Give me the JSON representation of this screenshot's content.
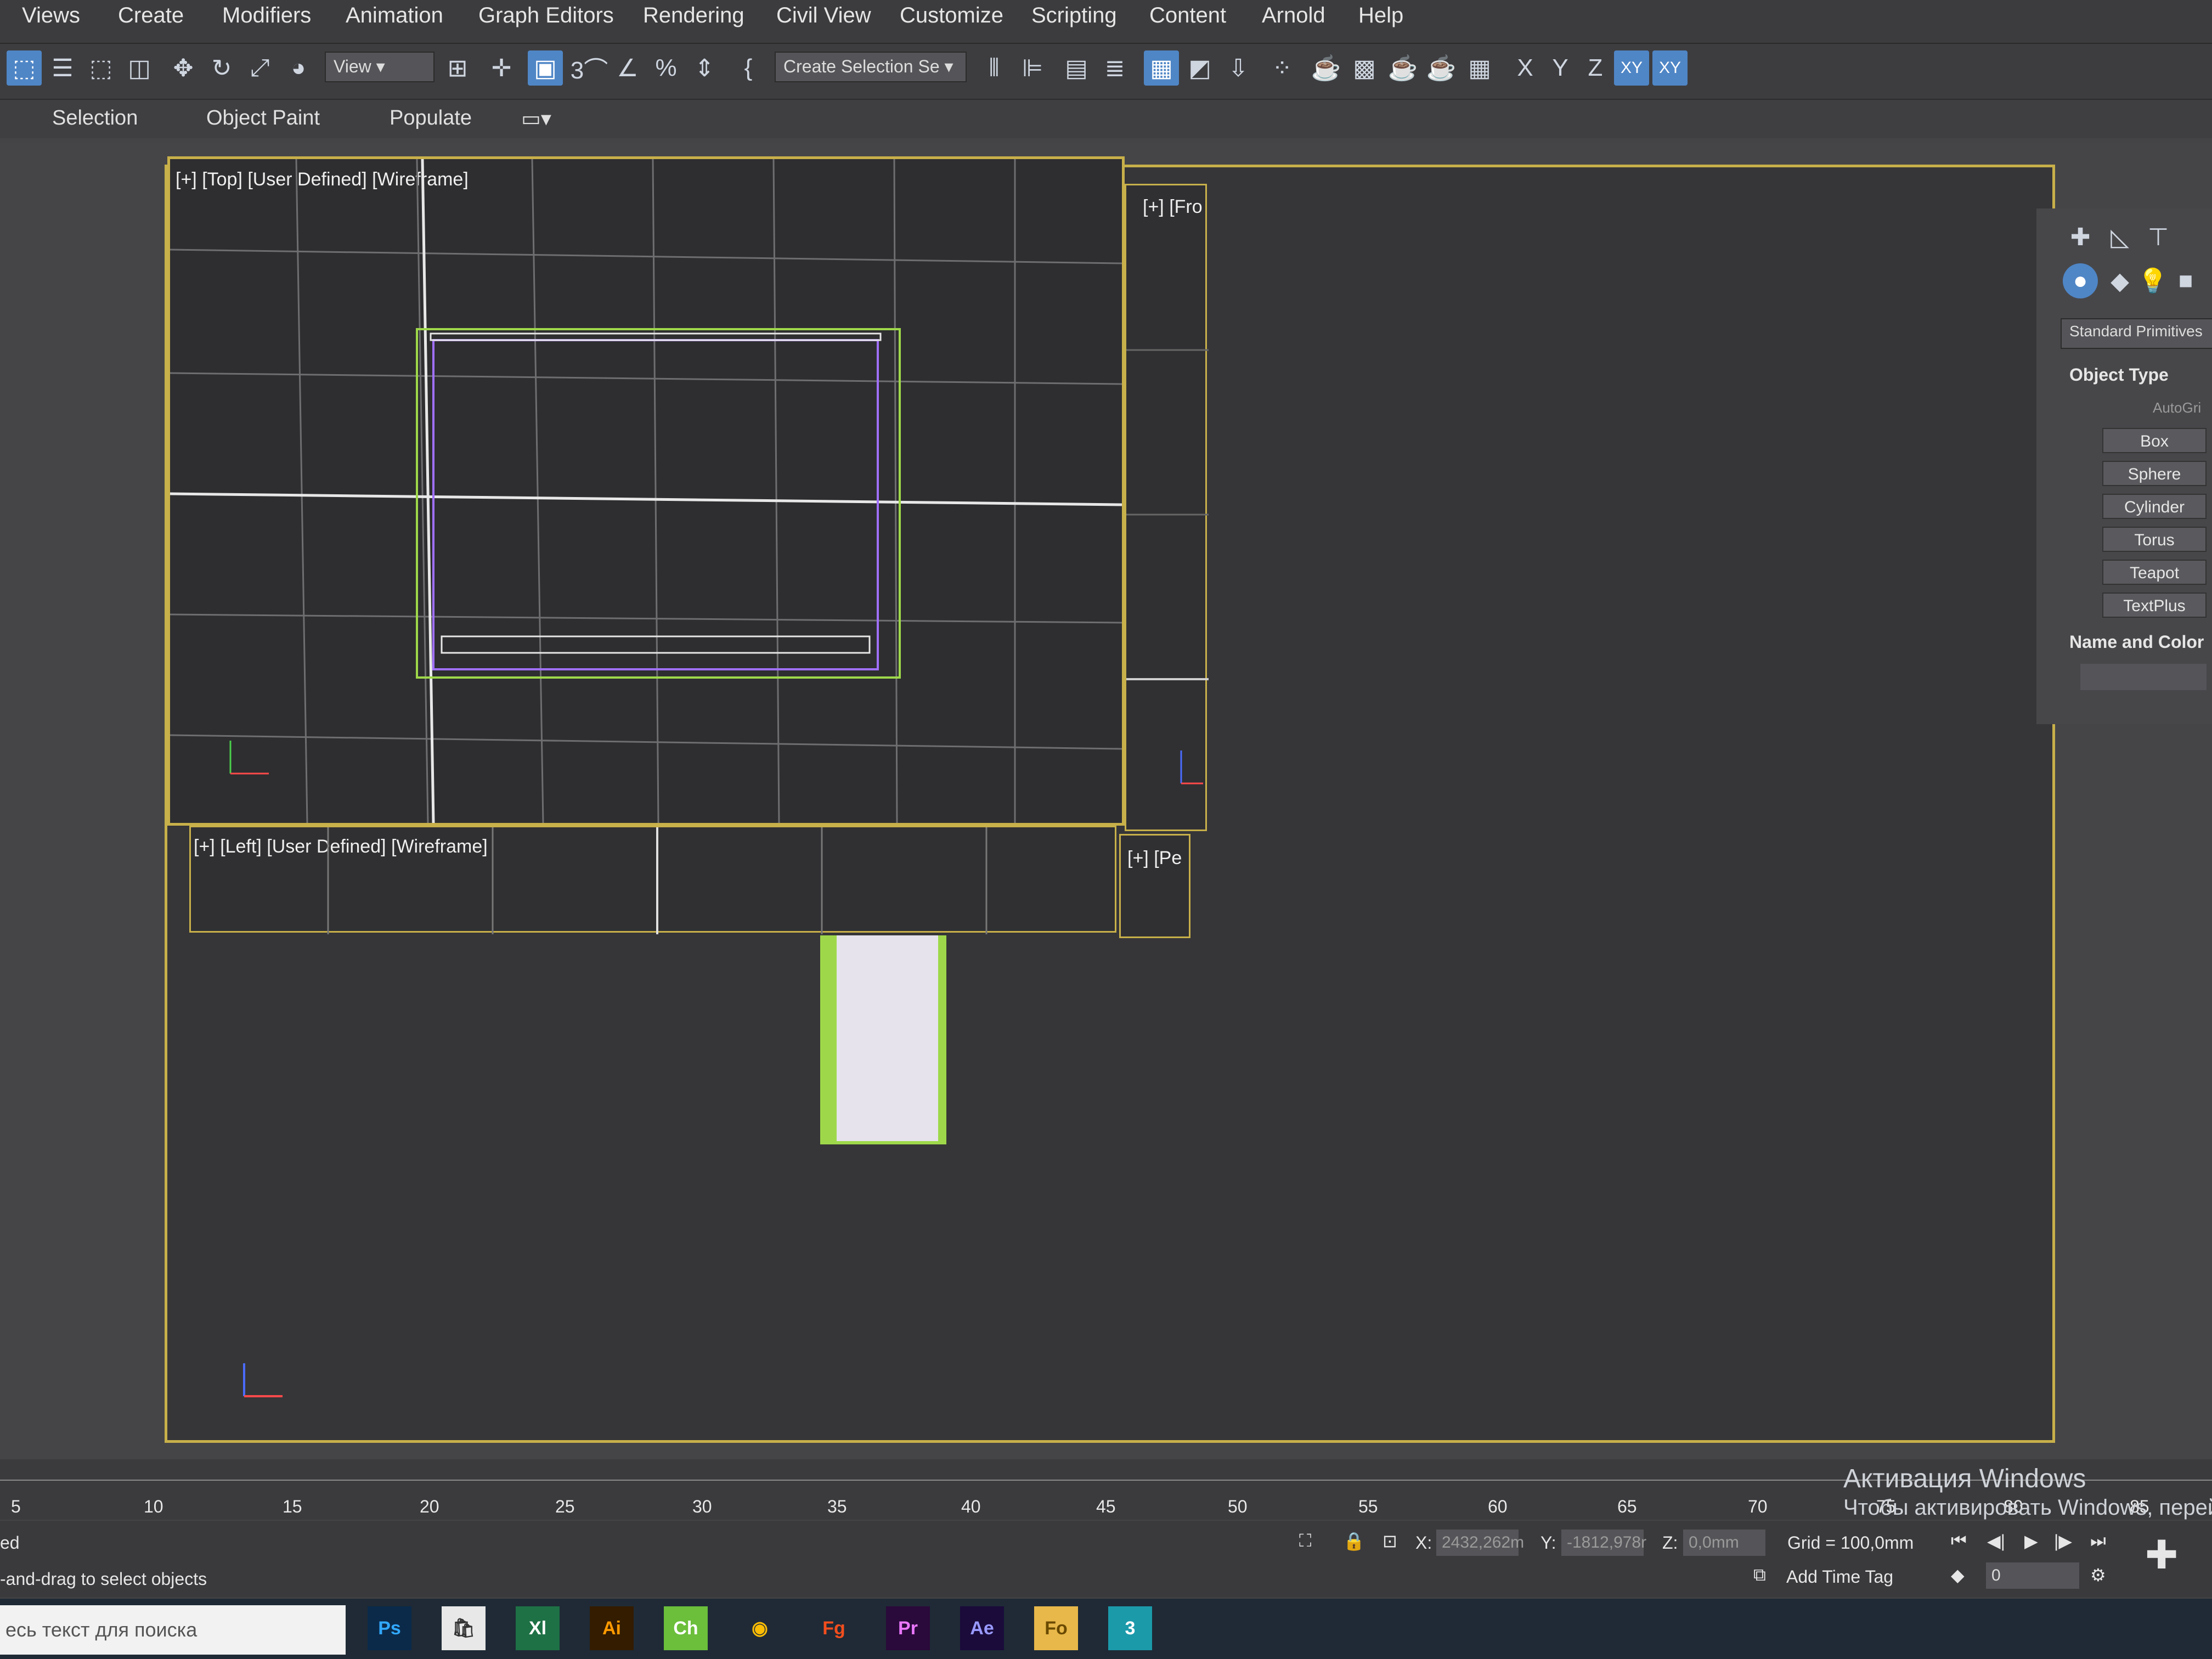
{
  "menu": [
    "Views",
    "Create",
    "Modifiers",
    "Animation",
    "Graph Editors",
    "Rendering",
    "Civil View",
    "Customize",
    "Scripting",
    "Content",
    "Arnold",
    "Help"
  ],
  "toolbar": {
    "view_dropdown": "View",
    "selection_set": "Create Selection Se",
    "axis_x": "X",
    "axis_y": "Y",
    "axis_z": "Z",
    "axis_xy": "XY",
    "axis_xy2": "XY"
  },
  "ribbon": [
    "Selection",
    "Object Paint",
    "Populate"
  ],
  "viewports": {
    "top_label": "[+] [Top] [User Defined] [Wireframe]",
    "front_label": "[+] [Fro",
    "left_label": "[+] [Left] [User Defined] [Wireframe]",
    "persp_label": "[+] [Pe"
  },
  "command_panel": {
    "category": "Standard Primitives",
    "object_type": "Object Type",
    "autogrid": "AutoGri",
    "buttons": [
      "Box",
      "Sphere",
      "Cylinder",
      "Torus",
      "Teapot",
      "TextPlus"
    ],
    "name_color": "Name and Color"
  },
  "timeline": {
    "ticks": [
      "5",
      "10",
      "15",
      "20",
      "25",
      "30",
      "35",
      "40",
      "45",
      "50",
      "55",
      "60",
      "65",
      "70",
      "75",
      "80",
      "85"
    ]
  },
  "status": {
    "selected": "ed",
    "prompt": "-and-drag to select objects",
    "x_label": "X:",
    "x_value": "2432,262m",
    "y_label": "Y:",
    "y_value": "-1812,978r",
    "z_label": "Z:",
    "z_value": "0,0mm",
    "grid": "Grid = 100,0mm",
    "add_time_tag": "Add Time Tag",
    "frame": "0"
  },
  "taskbar": {
    "search_placeholder": "есь текст для поиска",
    "apps": [
      "Ps",
      "Xl",
      "Ai",
      "Ch",
      "Fg",
      "Pr",
      "Ae",
      "Fo",
      "3"
    ]
  },
  "watermark": {
    "line1": "Активация Windows",
    "line2": "Чтобы активировать Windows, перей"
  }
}
